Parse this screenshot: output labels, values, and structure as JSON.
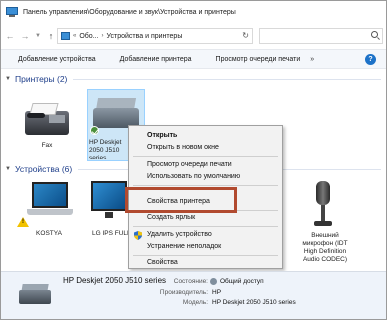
{
  "window": {
    "title": "Панель управления\\Оборудование и звук\\Устройства и принтеры"
  },
  "address": {
    "segments": [
      "Обо...",
      "Устройства и принтеры"
    ],
    "search_placeholder": ""
  },
  "toolbar": {
    "items": [
      "Добавление устройства",
      "Добавление принтера",
      "Просмотр очереди печати"
    ],
    "more": "»",
    "help": "?"
  },
  "groups": {
    "printers": "Принтеры (2)",
    "devices": "Устройства (6)"
  },
  "printers": [
    {
      "label": "Fax"
    },
    {
      "label": "HP Deskjet 2050 J510 series"
    }
  ],
  "devices": [
    {
      "label": "KOSTYA"
    },
    {
      "label": "LG IPS FULL"
    },
    {
      "label": "Внешний микрофон (IDT High Definition Audio CODEC)"
    }
  ],
  "context_menu": {
    "items": [
      {
        "label": "Открыть",
        "bold": true
      },
      {
        "label": "Открыть в новом окне"
      },
      {
        "label": "Просмотр очереди печати"
      },
      {
        "label": "Использовать по умолчанию"
      },
      {
        "label": "Свойства принтера"
      },
      {
        "label": "Создать ярлык"
      },
      {
        "label": "Удалить устройство"
      },
      {
        "label": "Устранение неполадок"
      },
      {
        "label": "Свойства"
      }
    ]
  },
  "details": {
    "name": "HP Deskjet 2050 J510 series",
    "state_label": "Состояние:",
    "state_value": "Общий доступ",
    "maker_label": "Производитель:",
    "maker_value": "HP",
    "model_label": "Модель:",
    "model_value": "HP Deskjet 2050 J510 series"
  },
  "colors": {
    "selection": "#cde6f7",
    "highlight_box": "#b14a2f",
    "group_title": "#1e3e8a"
  }
}
